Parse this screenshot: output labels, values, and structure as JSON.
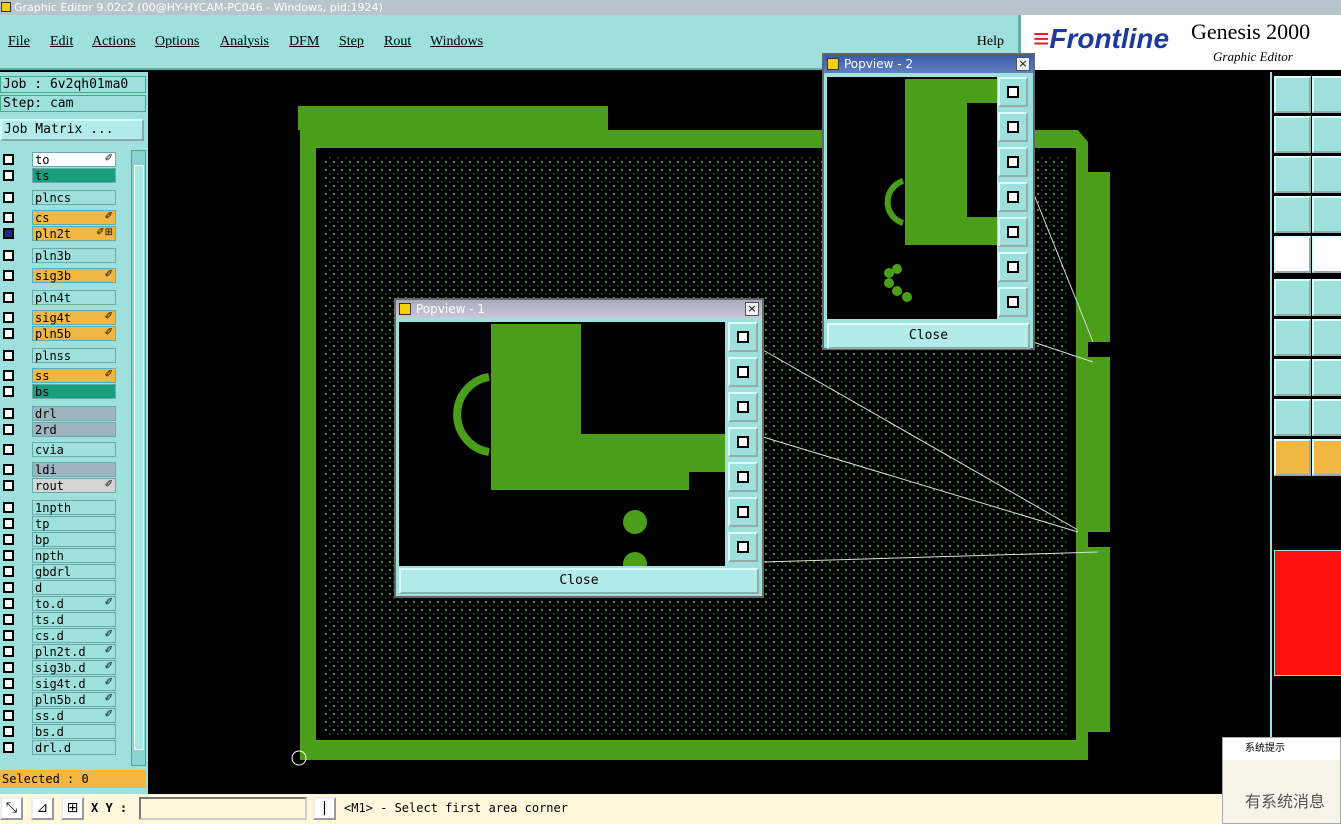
{
  "window": {
    "title": "Graphic Editor 9.02c2 (00@HY-HYCAM-PC046 - Windows, pid:1924)"
  },
  "menu": [
    "File",
    "Edit",
    "Actions",
    "Options",
    "Analysis",
    "DFM",
    "Step",
    "Rout",
    "Windows"
  ],
  "help": "Help",
  "brand": {
    "logo": "Frontline",
    "product": "Genesis 2000",
    "subtitle": "Graphic Editor"
  },
  "job": {
    "job": "Job : 6v2qh01ma0",
    "step": "Step: cam",
    "matrix_button": "Job Matrix ..."
  },
  "layers": [
    {
      "name": "to",
      "color": "#ffffff",
      "mark": "✐"
    },
    {
      "name": "ts",
      "color": "#1a9e7e",
      "mark": ""
    },
    {
      "name": "plncs",
      "color": "#9ee0dc",
      "mark": ""
    },
    {
      "name": "cs",
      "color": "#f2b742",
      "mark": "✐"
    },
    {
      "name": "pln2t",
      "color": "#f2b742",
      "mark": "✐⊞"
    },
    {
      "name": "pln3b",
      "color": "#9ee0dc",
      "mark": ""
    },
    {
      "name": "sig3b",
      "color": "#f2b742",
      "mark": "✐"
    },
    {
      "name": "pln4t",
      "color": "#9ee0dc",
      "mark": ""
    },
    {
      "name": "sig4t",
      "color": "#f2b742",
      "mark": "✐"
    },
    {
      "name": "pln5b",
      "color": "#f2b742",
      "mark": "✐"
    },
    {
      "name": "plnss",
      "color": "#9ee0dc",
      "mark": ""
    },
    {
      "name": "ss",
      "color": "#f2b742",
      "mark": "✐"
    },
    {
      "name": "bs",
      "color": "#1a9e7e",
      "mark": ""
    },
    {
      "name": "drl",
      "color": "#a0b4c0",
      "mark": ""
    },
    {
      "name": "2rd",
      "color": "#a0b4c0",
      "mark": ""
    },
    {
      "name": "cvia",
      "color": "#9ee0dc",
      "mark": ""
    },
    {
      "name": "ldi",
      "color": "#a0b4c0",
      "mark": ""
    },
    {
      "name": "rout",
      "color": "#d4d4d4",
      "mark": "✐"
    },
    {
      "name": "1npth",
      "color": "#9ee0dc",
      "mark": ""
    },
    {
      "name": "tp",
      "color": "#9ee0dc",
      "mark": ""
    },
    {
      "name": "bp",
      "color": "#9ee0dc",
      "mark": ""
    },
    {
      "name": "npth",
      "color": "#9ee0dc",
      "mark": ""
    },
    {
      "name": "gbdrl",
      "color": "#9ee0dc",
      "mark": ""
    },
    {
      "name": "d",
      "color": "#9ee0dc",
      "mark": ""
    },
    {
      "name": "to.d",
      "color": "#9ee0dc",
      "mark": "✐"
    },
    {
      "name": "ts.d",
      "color": "#9ee0dc",
      "mark": ""
    },
    {
      "name": "cs.d",
      "color": "#9ee0dc",
      "mark": "✐"
    },
    {
      "name": "pln2t.d",
      "color": "#9ee0dc",
      "mark": "✐"
    },
    {
      "name": "sig3b.d",
      "color": "#9ee0dc",
      "mark": "✐"
    },
    {
      "name": "sig4t.d",
      "color": "#9ee0dc",
      "mark": "✐"
    },
    {
      "name": "pln5b.d",
      "color": "#9ee0dc",
      "mark": "✐"
    },
    {
      "name": "ss.d",
      "color": "#9ee0dc",
      "mark": "✐"
    },
    {
      "name": "bs.d",
      "color": "#9ee0dc",
      "mark": ""
    },
    {
      "name": "drl.d",
      "color": "#9ee0dc",
      "mark": ""
    }
  ],
  "selected": "Selected : 0",
  "status": {
    "xy_label": "X Y :",
    "xy_value": "",
    "message": "<M1> - Select first area corner"
  },
  "popview1": {
    "title": "Popview - 1",
    "close": "Close"
  },
  "popview2": {
    "title": "Popview - 2",
    "close": "Close"
  },
  "sysnote": {
    "title": "系统提示",
    "body": "有系统消息"
  },
  "colors": {
    "board": "#4a9e1a",
    "pcb_dots": "#3e8a16"
  }
}
